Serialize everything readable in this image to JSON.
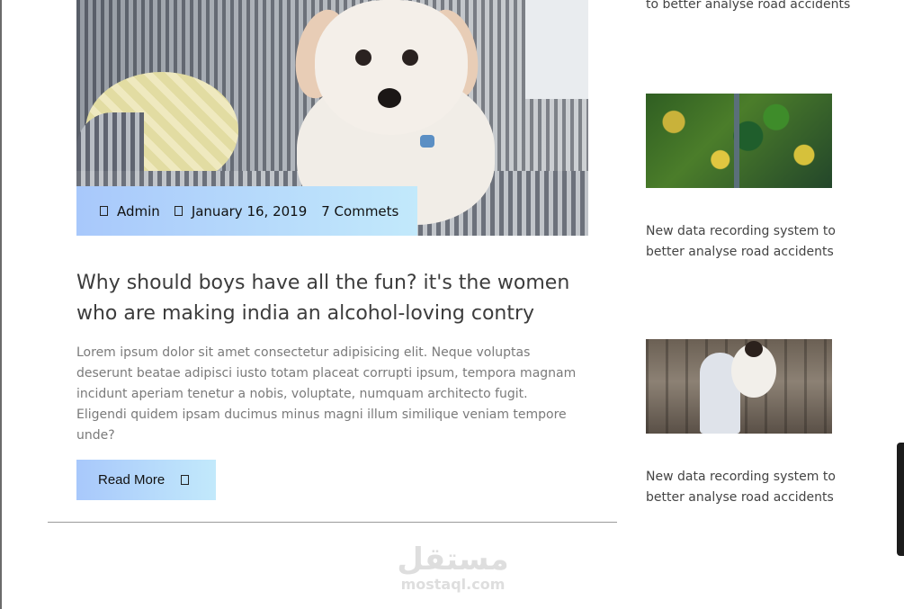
{
  "post": {
    "meta": {
      "author": "Admin",
      "date": "January 16, 2019",
      "comments": "7 Commets"
    },
    "title": "Why should boys have all the fun? it's the women who are making india an alcohol-loving contry",
    "excerpt": "Lorem ipsum dolor sit amet consectetur adipisicing elit. Neque voluptas deserunt beatae adipisci iusto totam placeat corrupti ipsum, tempora magnam incidunt aperiam tenetur a nobis, voluptate, numquam architecto fugit. Eligendi quidem ipsam ducimus minus magni illum similique veniam tempore unde?",
    "read_more_label": "Read More"
  },
  "sidebar": {
    "items": [
      {
        "title": "to better analyse road accidents"
      },
      {
        "title": "New data recording system to better analyse road accidents"
      },
      {
        "title": "New data recording system to better analyse road accidents"
      }
    ]
  },
  "watermark": {
    "arabic": "مستقل",
    "latin": "mostaql.com"
  },
  "colors": {
    "accent_gradient_start": "#a8c8fb",
    "accent_gradient_end": "#c2e9fb",
    "divider": "#9a9a9a"
  },
  "icons": {
    "author": "user-icon",
    "date": "calendar-icon",
    "read_more": "arrow-right-icon"
  }
}
